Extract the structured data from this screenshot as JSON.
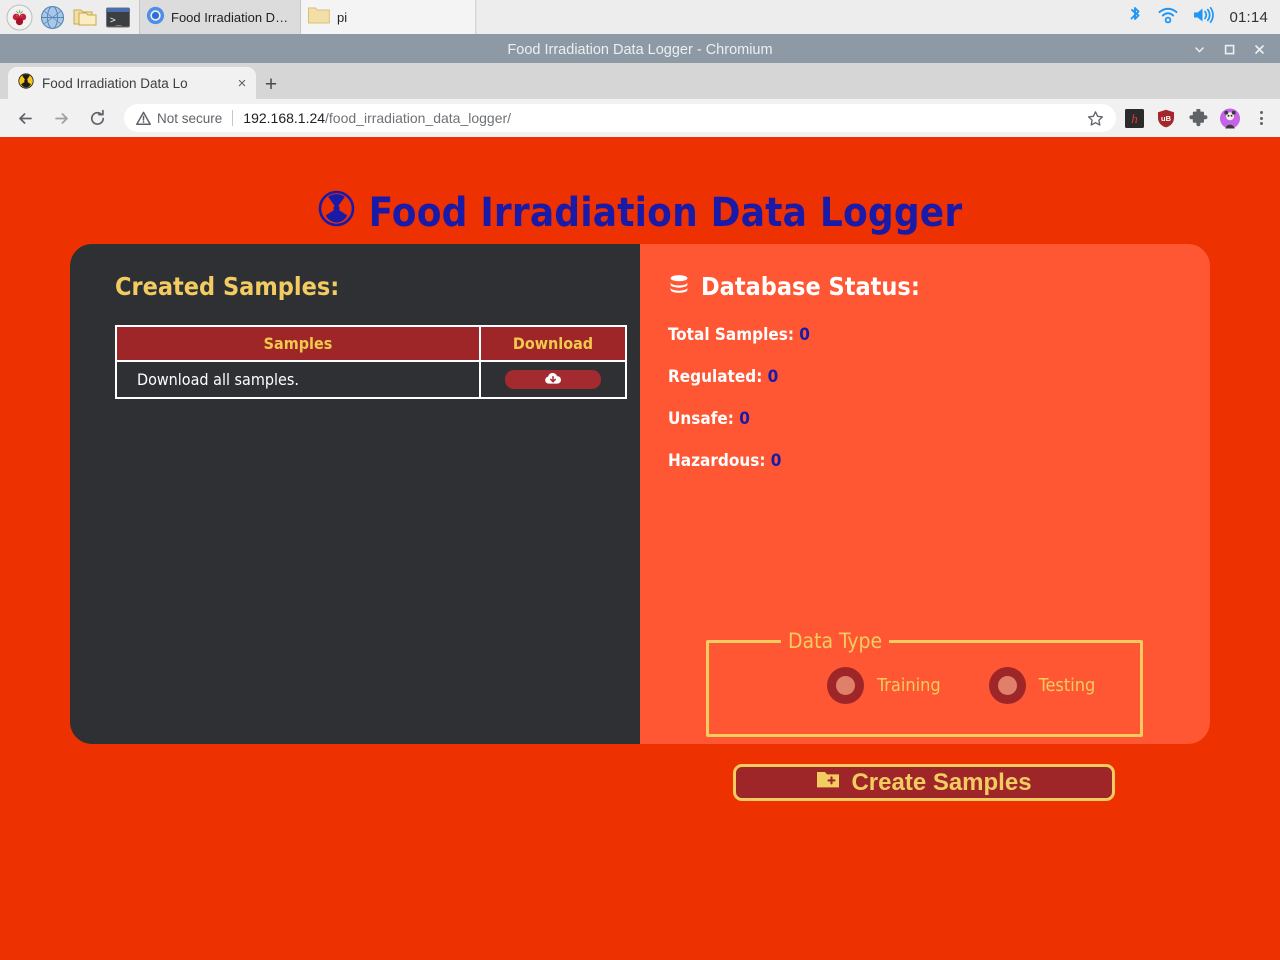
{
  "taskbar": {
    "launchers": [
      {
        "name": "raspberry-pi-menu-icon",
        "label": "Raspberry Pi Menu"
      },
      {
        "name": "web-browser-icon",
        "label": "Web Browser"
      },
      {
        "name": "file-manager-icon",
        "label": "File Manager"
      },
      {
        "name": "terminal-icon",
        "label": "Terminal"
      }
    ],
    "windows": [
      {
        "name": "taskbar-window-chromium",
        "label": "Food Irradiation Data...",
        "icon": "chromium-icon",
        "active": true
      },
      {
        "name": "taskbar-window-file-manager",
        "label": "pi",
        "icon": "folder-icon",
        "active": false
      }
    ],
    "tray": [
      {
        "name": "bluetooth-icon"
      },
      {
        "name": "wifi-icon"
      },
      {
        "name": "volume-icon"
      }
    ],
    "clock": "01:14"
  },
  "window": {
    "title": "Food Irradiation Data Logger - Chromium",
    "controls": {
      "minimize": "minimize-icon",
      "maximize": "maximize-icon",
      "close": "close-icon"
    }
  },
  "browser": {
    "tabs": [
      {
        "title": "Food Irradiation Data Lo",
        "favicon": "radiation-favicon"
      }
    ],
    "new_tab_label": "+",
    "close_tab_label": "×",
    "nav": {
      "back": "back-arrow-icon",
      "forward": "forward-arrow-icon",
      "reload": "reload-icon"
    },
    "omnibox": {
      "security_label": "Not secure",
      "url_host": "192.168.1.24",
      "url_path": "/food_irradiation_data_logger/",
      "bookmark": "star-icon"
    },
    "extensions": [
      {
        "name": "h-extension-icon",
        "label": "h"
      },
      {
        "name": "ublock-shield-icon",
        "label": "uB"
      },
      {
        "name": "extensions-puzzle-icon"
      },
      {
        "name": "profile-avatar-icon"
      },
      {
        "name": "chrome-menu-icon"
      }
    ]
  },
  "page": {
    "title": "Food Irradiation Data Logger",
    "title_icon": "radiation-icon",
    "colors": {
      "background": "#EE3100",
      "left_card": "#2E3033",
      "right_card": "#FF5733",
      "title_text": "#1A1AA8",
      "accent_yellow": "#F2CC61",
      "accent_dark_red": "#9E2629"
    },
    "left_card": {
      "heading": "Created Samples:",
      "table": {
        "headers": [
          "Samples",
          "Download"
        ],
        "rows": [
          {
            "sample": "Download all samples.",
            "download_icon": "cloud-download-icon"
          }
        ]
      }
    },
    "right_card": {
      "heading": "Database Status:",
      "heading_icon": "database-icon",
      "stats": [
        {
          "label": "Total Samples:",
          "value": "0"
        },
        {
          "label": "Regulated:",
          "value": "0"
        },
        {
          "label": "Unsafe:",
          "value": "0"
        },
        {
          "label": "Hazardous:",
          "value": "0"
        }
      ],
      "data_type": {
        "legend": "Data Type",
        "options": [
          {
            "label": "Training",
            "selected": false
          },
          {
            "label": "Testing",
            "selected": false
          }
        ]
      },
      "create_button": {
        "label": "Create Samples",
        "icon": "folder-plus-icon"
      }
    }
  }
}
